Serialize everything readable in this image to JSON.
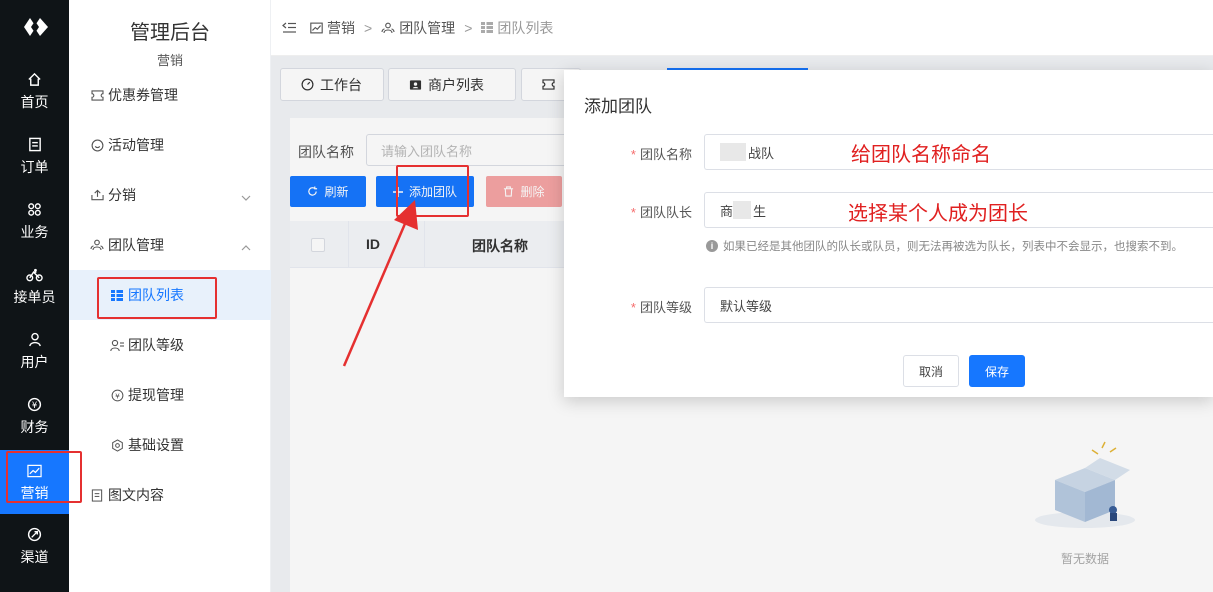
{
  "rail": {
    "items": [
      {
        "label": "首页",
        "icon": "home-icon"
      },
      {
        "label": "订单",
        "icon": "order-icon"
      },
      {
        "label": "业务",
        "icon": "grid-icon"
      },
      {
        "label": "接单员",
        "icon": "bike-icon"
      },
      {
        "label": "用户",
        "icon": "user-icon"
      },
      {
        "label": "财务",
        "icon": "money-icon"
      },
      {
        "label": "营销",
        "icon": "chart-icon",
        "active": true
      },
      {
        "label": "渠道",
        "icon": "channel-icon"
      }
    ]
  },
  "menu": {
    "title": "管理后台",
    "subtitle": "营销",
    "items": [
      {
        "label": "优惠券管理"
      },
      {
        "label": "活动管理"
      },
      {
        "label": "分销"
      },
      {
        "label": "团队管理"
      },
      {
        "label": "团队列表"
      },
      {
        "label": "团队等级"
      },
      {
        "label": "提现管理"
      },
      {
        "label": "基础设置"
      },
      {
        "label": "图文内容"
      }
    ]
  },
  "breadcrumb": [
    "营销",
    "团队管理",
    "团队列表"
  ],
  "tabs": [
    {
      "label": "工作台"
    },
    {
      "label": "商户列表"
    }
  ],
  "search": {
    "label": "团队名称",
    "placeholder": "请输入团队名称"
  },
  "toolbar": {
    "refresh": "刷新",
    "add": "添加团队",
    "delete": "删除"
  },
  "table": {
    "columns": [
      "ID",
      "团队名称"
    ]
  },
  "empty_text": "暂无数据",
  "dialog": {
    "title": "添加团队",
    "fields": [
      {
        "label": "团队名称",
        "value": "战队"
      },
      {
        "label": "团队队长",
        "value_prefix": "商",
        "value": "生"
      },
      {
        "label": "团队等级",
        "value": "默认等级"
      }
    ],
    "hint": "如果已经是其他团队的队长或队员，则无法再被选为队长，列表中不会显示，也搜索不到。",
    "cancel": "取消",
    "save": "保存"
  },
  "annotations": {
    "name_note": "给团队名称命名",
    "leader_note": "选择某个人成为团长"
  },
  "colors": {
    "primary": "#1677ff",
    "rail_bg": "#0f1417",
    "annotation_red": "#e53030"
  }
}
